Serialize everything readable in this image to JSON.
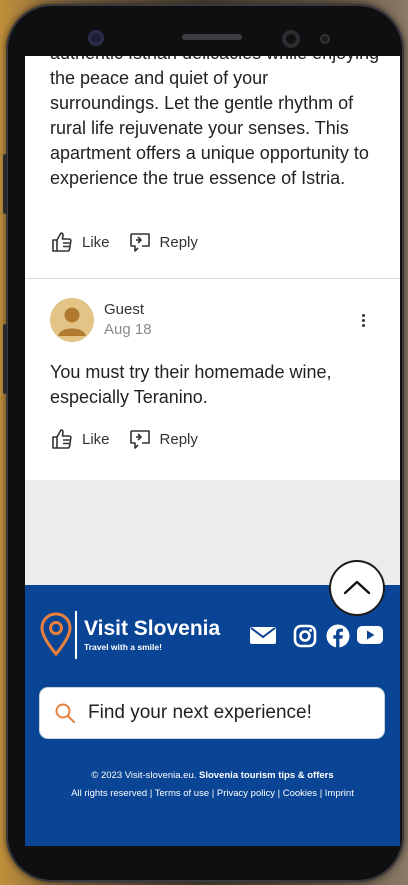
{
  "comments": [
    {
      "text": "authentic Istrian delicacies while enjoying the peace and quiet of your surroundings. Let the gentle rhythm of rural life rejuvenate your senses. This apartment offers a unique opportunity to experience the true essence of Istria.",
      "like_label": "Like",
      "reply_label": "Reply"
    },
    {
      "author": "Guest",
      "date": "Aug 18",
      "text": "You must try their homemade wine, especially Teranino.",
      "like_label": "Like",
      "reply_label": "Reply"
    }
  ],
  "footer": {
    "brand": "Visit Slovenia",
    "tagline": "Travel with a smile!",
    "social_icons": [
      "mail-icon",
      "instagram-icon",
      "facebook-icon",
      "youtube-icon"
    ],
    "search": {
      "placeholder": "Find your next experience!"
    },
    "copyright_prefix": "© 2023 Visit-slovenia.eu.",
    "copyright_bold": "Slovenia tourism tips & offers",
    "links": [
      "All rights reserved",
      "Terms of use",
      "Privacy policy",
      "Cookies",
      "Imprint"
    ],
    "separator": "|"
  },
  "colors": {
    "footer_bg": "#0a4595",
    "accent": "#e8803d",
    "text": "#222222"
  }
}
